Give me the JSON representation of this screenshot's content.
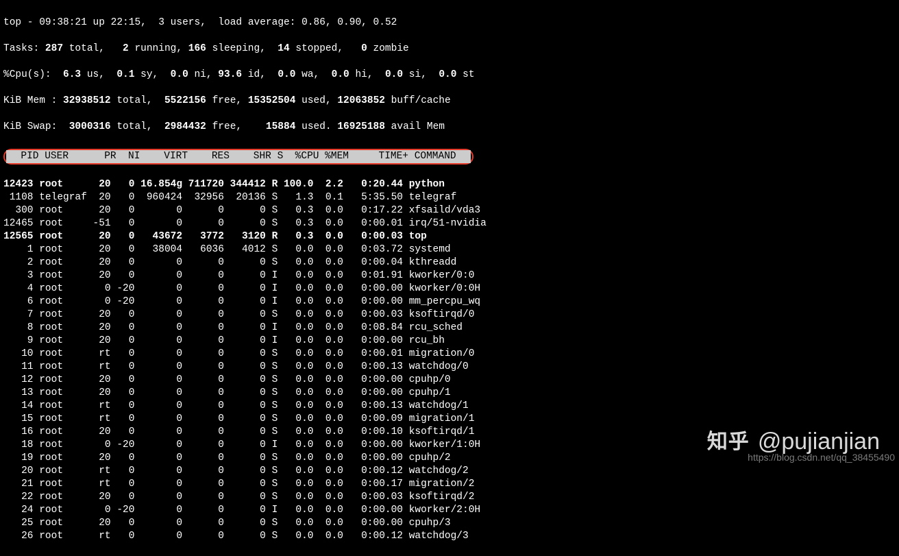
{
  "summary": {
    "line1_pre": "top - ",
    "time": "09:38:21",
    "uptime_pre": " up ",
    "uptime": "22:15",
    "users_pre": ",  ",
    "users": "3 users",
    "loadavg_pre": ",  load average: ",
    "loadavg": "0.86, 0.90, 0.52",
    "tasks_label": "Tasks: ",
    "tasks_total": "287",
    "tasks_total_suf": " total,   ",
    "tasks_running": "2",
    "tasks_running_suf": " running, ",
    "tasks_sleeping": "166",
    "tasks_sleeping_suf": " sleeping,  ",
    "tasks_stopped": "14",
    "tasks_stopped_suf": " stopped,   ",
    "tasks_zombie": "0",
    "tasks_zombie_suf": " zombie",
    "cpu_label": "%Cpu(s):  ",
    "cpu_us": "6.3",
    "cpu_us_suf": " us,  ",
    "cpu_sy": "0.1",
    "cpu_sy_suf": " sy,  ",
    "cpu_ni": "0.0",
    "cpu_ni_suf": " ni, ",
    "cpu_id": "93.6",
    "cpu_id_suf": " id,  ",
    "cpu_wa": "0.0",
    "cpu_wa_suf": " wa,  ",
    "cpu_hi": "0.0",
    "cpu_hi_suf": " hi,  ",
    "cpu_si": "0.0",
    "cpu_si_suf": " si,  ",
    "cpu_st": "0.0",
    "cpu_st_suf": " st",
    "mem_label": "KiB Mem : ",
    "mem_total": "32938512",
    "mem_total_suf": " total,  ",
    "mem_free": "5522156",
    "mem_free_suf": " free, ",
    "mem_used": "15352504",
    "mem_used_suf": " used, ",
    "mem_buff": "12063852",
    "mem_buff_suf": " buff/cache",
    "swap_label": "KiB Swap:  ",
    "swap_total": "3000316",
    "swap_total_suf": " total,  ",
    "swap_free": "2984432",
    "swap_free_suf": " free,    ",
    "swap_used": "15884",
    "swap_used_suf": " used. ",
    "swap_avail": "16925188",
    "swap_avail_suf": " avail Mem"
  },
  "header": "  PID USER      PR  NI    VIRT    RES    SHR S  %CPU %MEM     TIME+ COMMAND ",
  "processes": [
    {
      "pid": "12423",
      "user": "root",
      "pr": "20",
      "ni": "0",
      "virt": "16.854g",
      "res": "711720",
      "shr": "344412",
      "s": "R",
      "cpu": "100.0",
      "mem": "2.2",
      "time": "0:20.44",
      "cmd": "python",
      "bold": true
    },
    {
      "pid": "1108",
      "user": "telegraf",
      "pr": "20",
      "ni": "0",
      "virt": "960424",
      "res": "32956",
      "shr": "20136",
      "s": "S",
      "cpu": "1.3",
      "mem": "0.1",
      "time": "5:35.50",
      "cmd": "telegraf",
      "bold": false
    },
    {
      "pid": "300",
      "user": "root",
      "pr": "20",
      "ni": "0",
      "virt": "0",
      "res": "0",
      "shr": "0",
      "s": "S",
      "cpu": "0.3",
      "mem": "0.0",
      "time": "0:17.22",
      "cmd": "xfsaild/vda3",
      "bold": false
    },
    {
      "pid": "12465",
      "user": "root",
      "pr": "-51",
      "ni": "0",
      "virt": "0",
      "res": "0",
      "shr": "0",
      "s": "S",
      "cpu": "0.3",
      "mem": "0.0",
      "time": "0:00.01",
      "cmd": "irq/51-nvidia",
      "bold": false
    },
    {
      "pid": "12565",
      "user": "root",
      "pr": "20",
      "ni": "0",
      "virt": "43672",
      "res": "3772",
      "shr": "3120",
      "s": "R",
      "cpu": "0.3",
      "mem": "0.0",
      "time": "0:00.03",
      "cmd": "top",
      "bold": true
    },
    {
      "pid": "1",
      "user": "root",
      "pr": "20",
      "ni": "0",
      "virt": "38004",
      "res": "6036",
      "shr": "4012",
      "s": "S",
      "cpu": "0.0",
      "mem": "0.0",
      "time": "0:03.72",
      "cmd": "systemd",
      "bold": false
    },
    {
      "pid": "2",
      "user": "root",
      "pr": "20",
      "ni": "0",
      "virt": "0",
      "res": "0",
      "shr": "0",
      "s": "S",
      "cpu": "0.0",
      "mem": "0.0",
      "time": "0:00.04",
      "cmd": "kthreadd",
      "bold": false
    },
    {
      "pid": "3",
      "user": "root",
      "pr": "20",
      "ni": "0",
      "virt": "0",
      "res": "0",
      "shr": "0",
      "s": "I",
      "cpu": "0.0",
      "mem": "0.0",
      "time": "0:01.91",
      "cmd": "kworker/0:0",
      "bold": false
    },
    {
      "pid": "4",
      "user": "root",
      "pr": "0",
      "ni": "-20",
      "virt": "0",
      "res": "0",
      "shr": "0",
      "s": "I",
      "cpu": "0.0",
      "mem": "0.0",
      "time": "0:00.00",
      "cmd": "kworker/0:0H",
      "bold": false
    },
    {
      "pid": "6",
      "user": "root",
      "pr": "0",
      "ni": "-20",
      "virt": "0",
      "res": "0",
      "shr": "0",
      "s": "I",
      "cpu": "0.0",
      "mem": "0.0",
      "time": "0:00.00",
      "cmd": "mm_percpu_wq",
      "bold": false
    },
    {
      "pid": "7",
      "user": "root",
      "pr": "20",
      "ni": "0",
      "virt": "0",
      "res": "0",
      "shr": "0",
      "s": "S",
      "cpu": "0.0",
      "mem": "0.0",
      "time": "0:00.03",
      "cmd": "ksoftirqd/0",
      "bold": false
    },
    {
      "pid": "8",
      "user": "root",
      "pr": "20",
      "ni": "0",
      "virt": "0",
      "res": "0",
      "shr": "0",
      "s": "I",
      "cpu": "0.0",
      "mem": "0.0",
      "time": "0:08.84",
      "cmd": "rcu_sched",
      "bold": false
    },
    {
      "pid": "9",
      "user": "root",
      "pr": "20",
      "ni": "0",
      "virt": "0",
      "res": "0",
      "shr": "0",
      "s": "I",
      "cpu": "0.0",
      "mem": "0.0",
      "time": "0:00.00",
      "cmd": "rcu_bh",
      "bold": false
    },
    {
      "pid": "10",
      "user": "root",
      "pr": "rt",
      "ni": "0",
      "virt": "0",
      "res": "0",
      "shr": "0",
      "s": "S",
      "cpu": "0.0",
      "mem": "0.0",
      "time": "0:00.01",
      "cmd": "migration/0",
      "bold": false
    },
    {
      "pid": "11",
      "user": "root",
      "pr": "rt",
      "ni": "0",
      "virt": "0",
      "res": "0",
      "shr": "0",
      "s": "S",
      "cpu": "0.0",
      "mem": "0.0",
      "time": "0:00.13",
      "cmd": "watchdog/0",
      "bold": false
    },
    {
      "pid": "12",
      "user": "root",
      "pr": "20",
      "ni": "0",
      "virt": "0",
      "res": "0",
      "shr": "0",
      "s": "S",
      "cpu": "0.0",
      "mem": "0.0",
      "time": "0:00.00",
      "cmd": "cpuhp/0",
      "bold": false
    },
    {
      "pid": "13",
      "user": "root",
      "pr": "20",
      "ni": "0",
      "virt": "0",
      "res": "0",
      "shr": "0",
      "s": "S",
      "cpu": "0.0",
      "mem": "0.0",
      "time": "0:00.00",
      "cmd": "cpuhp/1",
      "bold": false
    },
    {
      "pid": "14",
      "user": "root",
      "pr": "rt",
      "ni": "0",
      "virt": "0",
      "res": "0",
      "shr": "0",
      "s": "S",
      "cpu": "0.0",
      "mem": "0.0",
      "time": "0:00.13",
      "cmd": "watchdog/1",
      "bold": false
    },
    {
      "pid": "15",
      "user": "root",
      "pr": "rt",
      "ni": "0",
      "virt": "0",
      "res": "0",
      "shr": "0",
      "s": "S",
      "cpu": "0.0",
      "mem": "0.0",
      "time": "0:00.09",
      "cmd": "migration/1",
      "bold": false
    },
    {
      "pid": "16",
      "user": "root",
      "pr": "20",
      "ni": "0",
      "virt": "0",
      "res": "0",
      "shr": "0",
      "s": "S",
      "cpu": "0.0",
      "mem": "0.0",
      "time": "0:00.10",
      "cmd": "ksoftirqd/1",
      "bold": false
    },
    {
      "pid": "18",
      "user": "root",
      "pr": "0",
      "ni": "-20",
      "virt": "0",
      "res": "0",
      "shr": "0",
      "s": "I",
      "cpu": "0.0",
      "mem": "0.0",
      "time": "0:00.00",
      "cmd": "kworker/1:0H",
      "bold": false
    },
    {
      "pid": "19",
      "user": "root",
      "pr": "20",
      "ni": "0",
      "virt": "0",
      "res": "0",
      "shr": "0",
      "s": "S",
      "cpu": "0.0",
      "mem": "0.0",
      "time": "0:00.00",
      "cmd": "cpuhp/2",
      "bold": false
    },
    {
      "pid": "20",
      "user": "root",
      "pr": "rt",
      "ni": "0",
      "virt": "0",
      "res": "0",
      "shr": "0",
      "s": "S",
      "cpu": "0.0",
      "mem": "0.0",
      "time": "0:00.12",
      "cmd": "watchdog/2",
      "bold": false
    },
    {
      "pid": "21",
      "user": "root",
      "pr": "rt",
      "ni": "0",
      "virt": "0",
      "res": "0",
      "shr": "0",
      "s": "S",
      "cpu": "0.0",
      "mem": "0.0",
      "time": "0:00.17",
      "cmd": "migration/2",
      "bold": false
    },
    {
      "pid": "22",
      "user": "root",
      "pr": "20",
      "ni": "0",
      "virt": "0",
      "res": "0",
      "shr": "0",
      "s": "S",
      "cpu": "0.0",
      "mem": "0.0",
      "time": "0:00.03",
      "cmd": "ksoftirqd/2",
      "bold": false
    },
    {
      "pid": "24",
      "user": "root",
      "pr": "0",
      "ni": "-20",
      "virt": "0",
      "res": "0",
      "shr": "0",
      "s": "I",
      "cpu": "0.0",
      "mem": "0.0",
      "time": "0:00.00",
      "cmd": "kworker/2:0H",
      "bold": false
    },
    {
      "pid": "25",
      "user": "root",
      "pr": "20",
      "ni": "0",
      "virt": "0",
      "res": "0",
      "shr": "0",
      "s": "S",
      "cpu": "0.0",
      "mem": "0.0",
      "time": "0:00.00",
      "cmd": "cpuhp/3",
      "bold": false
    },
    {
      "pid": "26",
      "user": "root",
      "pr": "rt",
      "ni": "0",
      "virt": "0",
      "res": "0",
      "shr": "0",
      "s": "S",
      "cpu": "0.0",
      "mem": "0.0",
      "time": "0:00.12",
      "cmd": "watchdog/3",
      "bold": false
    }
  ],
  "watermark": {
    "site": "知乎",
    "handle": "@pujianjian",
    "csdn": "https://blog.csdn.net/qq_38455490"
  }
}
